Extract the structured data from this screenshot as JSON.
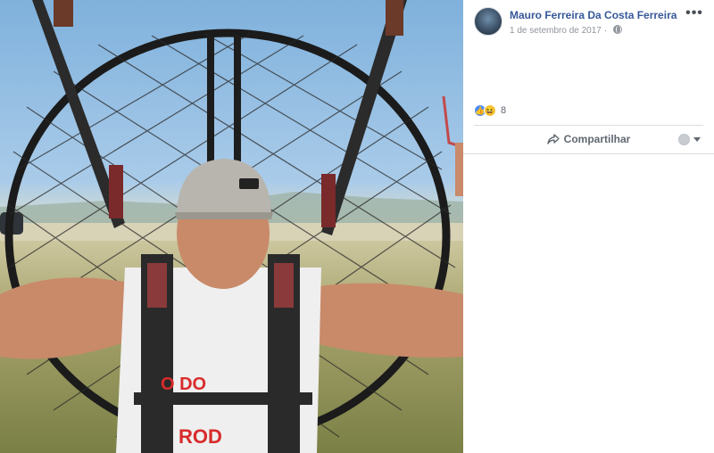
{
  "post": {
    "author_name": "Mauro Ferreira Da Costa Ferreira",
    "date": "1 de setembro de 2017",
    "privacy_icon": "globe-icon",
    "more_label": "•••"
  },
  "reactions": {
    "types": [
      "like-icon",
      "haha-icon"
    ],
    "count": "8"
  },
  "actions": {
    "share_label": "Compartilhar"
  },
  "photo": {
    "shirt_text_top": "O DO",
    "shirt_text_bottom": "ROD"
  },
  "colors": {
    "link": "#365899",
    "meta": "#90949c",
    "like": "#4f8df7",
    "haha": "#f7c638",
    "sky": "#7fb1dc",
    "cap": "#b8b5ae",
    "shirt_print": "#d92b2b"
  }
}
